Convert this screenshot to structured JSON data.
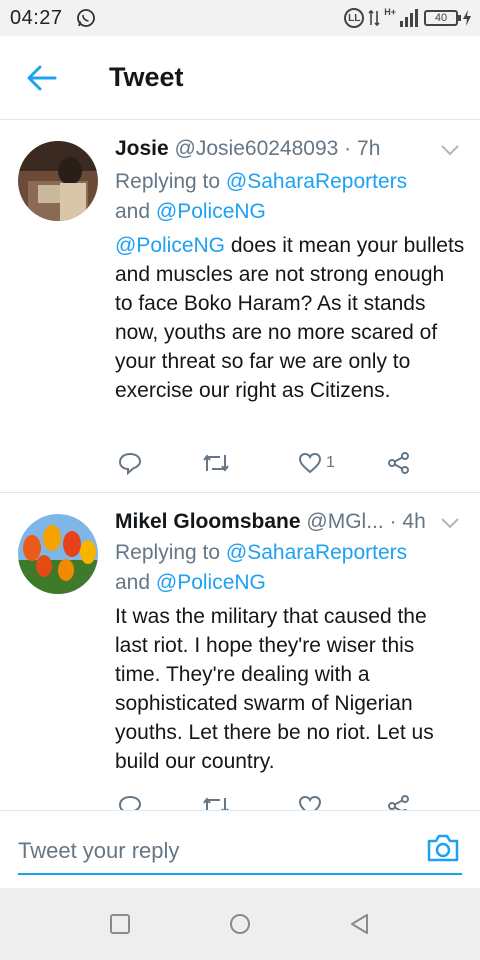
{
  "status_bar": {
    "time": "04:27",
    "network_badge": "LL",
    "network_type": "H+",
    "battery": "40"
  },
  "header": {
    "title": "Tweet",
    "back_icon": "arrow-left-icon"
  },
  "tweets": [
    {
      "name": "Josie",
      "handle": "@Josie60248093",
      "separator": "·",
      "time": "7h",
      "replying_prefix": "Replying to ",
      "reply_to_1": "@SaharaReporters",
      "reply_and": "and ",
      "reply_to_2": "@PoliceNG",
      "mention": "@PoliceNG",
      "body": " does it mean your bullets and muscles are not strong enough to face Boko Haram? As it stands now, youths are no more scared of your threat so far we are only to exercise our right as Citizens.",
      "like_count": "1"
    },
    {
      "name": "Mikel Gloomsbane",
      "handle": "@MGl...",
      "separator": "·",
      "time": "4h",
      "replying_prefix": "Replying to ",
      "reply_to_1": "@SaharaReporters",
      "reply_and": "and ",
      "reply_to_2": "@PoliceNG",
      "body": "It was the military that caused the last riot. I hope they're wiser this time. They're dealing with a sophisticated swarm of Nigerian youths. Let there be no riot. Let us build our country."
    }
  ],
  "composer": {
    "placeholder": "Tweet your reply"
  },
  "colors": {
    "accent": "#1da1f2",
    "secondary_text": "#657786",
    "primary_text": "#14171a",
    "divider": "#e1e8ed"
  }
}
